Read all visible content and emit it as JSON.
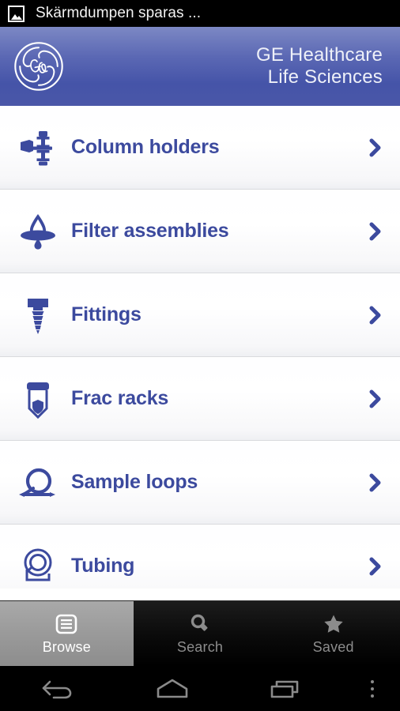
{
  "status_bar": {
    "icon": "screenshot-image-icon",
    "text": "Skärmdumpen sparas ..."
  },
  "header": {
    "logo": "ge-monogram-logo",
    "brand_line1": "GE Healthcare",
    "brand_line2": "Life Sciences",
    "gradient_top": "#7c88c4",
    "gradient_bottom": "#4554a8"
  },
  "list": {
    "accent_color": "#3c4a9e",
    "chevron": "chevron-right-icon",
    "items": [
      {
        "label": "Column holders",
        "icon": "column-holder-icon"
      },
      {
        "label": "Filter assemblies",
        "icon": "filter-droplet-icon"
      },
      {
        "label": "Fittings",
        "icon": "screw-fitting-icon"
      },
      {
        "label": "Frac racks",
        "icon": "test-tube-icon"
      },
      {
        "label": "Sample loops",
        "icon": "sample-loop-icon"
      },
      {
        "label": "Tubing",
        "icon": "tubing-coil-icon"
      }
    ]
  },
  "tabbar": {
    "active_index": 0,
    "tabs": [
      {
        "label": "Browse",
        "icon": "list-browse-icon",
        "active": true
      },
      {
        "label": "Search",
        "icon": "magnifier-icon",
        "active": false
      },
      {
        "label": "Saved",
        "icon": "star-icon",
        "active": false
      }
    ]
  },
  "navbar": {
    "buttons": [
      {
        "name": "back",
        "icon": "back-arrow-icon"
      },
      {
        "name": "home",
        "icon": "home-icon"
      },
      {
        "name": "recents",
        "icon": "recent-apps-icon"
      },
      {
        "name": "menu",
        "icon": "overflow-menu-icon"
      }
    ]
  }
}
